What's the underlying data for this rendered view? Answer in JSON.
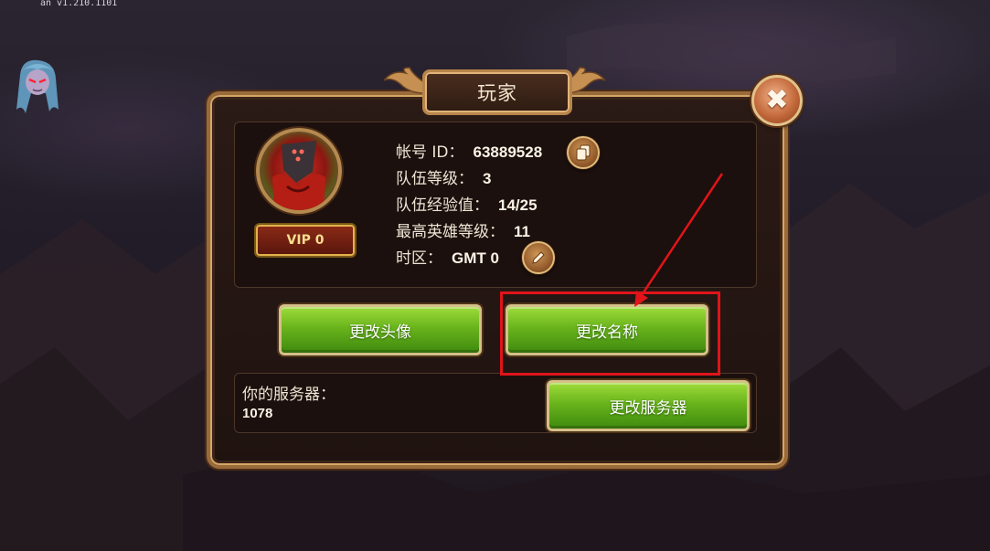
{
  "version_label": "an v1.210.1101",
  "dialog": {
    "title": "玩家",
    "close_icon": "close-icon"
  },
  "player": {
    "vip_label": "VIP 0",
    "account_id_label": "帐号 ID：",
    "account_id_value": "63889528",
    "team_level_label": "队伍等级：",
    "team_level_value": "3",
    "team_exp_label": "队伍经验值：",
    "team_exp_value": "14/25",
    "max_hero_level_label": "最高英雄等级：",
    "max_hero_level_value": "11",
    "timezone_label": "时区：",
    "timezone_value": "GMT 0"
  },
  "buttons": {
    "change_avatar": "更改头像",
    "change_name": "更改名称",
    "change_server": "更改服务器"
  },
  "server": {
    "label": "你的服务器：",
    "value": "1078"
  },
  "icons": {
    "copy": "copy-icon",
    "edit": "pencil-icon"
  },
  "colors": {
    "button_green": "#69b41c",
    "frame_gold": "#b7844a",
    "highlight_red": "#e0141a"
  }
}
